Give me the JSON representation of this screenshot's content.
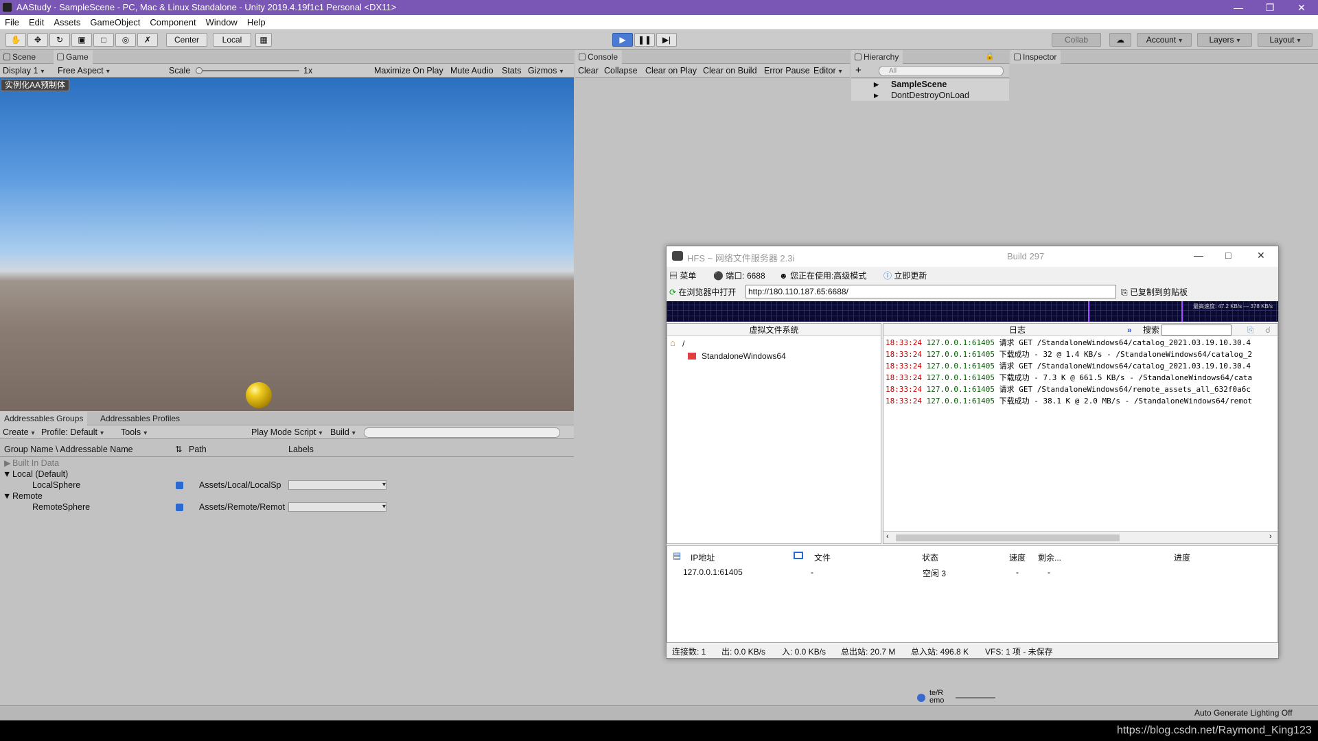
{
  "window": {
    "title": "AAStudy - SampleScene - PC, Mac & Linux Standalone - Unity 2019.4.19f1c1 Personal <DX11>"
  },
  "menu": [
    "File",
    "Edit",
    "Assets",
    "GameObject",
    "Component",
    "Window",
    "Help"
  ],
  "toolbar": {
    "center": "Center",
    "local": "Local",
    "collab": "Collab",
    "account": "Account",
    "layers": "Layers",
    "layout": "Layout"
  },
  "game": {
    "tab_scene": "Scene",
    "tab_game": "Game",
    "display": "Display 1",
    "aspect": "Free Aspect",
    "scale_label": "Scale",
    "scale_value": "1x",
    "maximize": "Maximize On Play",
    "mute": "Mute Audio",
    "stats": "Stats",
    "gizmos": "Gizmos",
    "instantiate_button": "实例化AA预制体"
  },
  "addressables": {
    "tab_groups": "Addressables Groups",
    "tab_profiles": "Addressables Profiles",
    "create": "Create",
    "profile": "Profile: Default",
    "tools": "Tools",
    "play_mode": "Play Mode Script",
    "build": "Build",
    "col_name": "Group Name \\ Addressable Name",
    "col_path": "Path",
    "col_labels": "Labels",
    "rows": [
      {
        "name": "Built In Data",
        "path": ""
      },
      {
        "name": "Local (Default)",
        "path": ""
      },
      {
        "name": "LocalSphere",
        "path": "Assets/Local/LocalSp"
      },
      {
        "name": "Remote",
        "path": ""
      },
      {
        "name": "RemoteSphere",
        "path": "Assets/Remote/Remot"
      }
    ]
  },
  "console": {
    "tab": "Console",
    "clear": "Clear",
    "collapse": "Collapse",
    "clear_on_play": "Clear on Play",
    "clear_on_build": "Clear on Build",
    "error_pause": "Error Pause",
    "editor": "Editor"
  },
  "hierarchy": {
    "tab": "Hierarchy",
    "search_placeholder": "All",
    "items": [
      "SampleScene",
      "DontDestroyOnLoad"
    ],
    "bottom_text": "te/R emo"
  },
  "inspector": {
    "tab": "Inspector"
  },
  "status": {
    "right": "Auto Generate Lighting Off"
  },
  "watermark": "https://blog.csdn.net/Raymond_King123",
  "hfs": {
    "title": "HFS ~ 网络文件服务器 2.3i",
    "build": "Build 297",
    "menu": "菜单",
    "port": "端口: 6688",
    "mode": "您正在使用:高级模式",
    "update": "立即更新",
    "open_browser": "在浏览器中打开",
    "url": "http://180.110.187.65:6688/",
    "copied": "已复制到剪贴板",
    "graph_label": "最高速度: 47.2 KB/s --- 378 KB/s",
    "vfs_header": "虚拟文件系统",
    "log_header": "日志",
    "search": "搜索",
    "vfs_root": "/",
    "vfs_folder": "StandaloneWindows64",
    "log": [
      {
        "t": "18:33:24",
        "ip": "127.0.0.1:61405",
        "m": "请求 GET /StandaloneWindows64/catalog_2021.03.19.10.30.4"
      },
      {
        "t": "18:33:24",
        "ip": "127.0.0.1:61405",
        "m": "下载成功 - 32 @ 1.4 KB/s - /StandaloneWindows64/catalog_2"
      },
      {
        "t": "18:33:24",
        "ip": "127.0.0.1:61405",
        "m": "请求 GET /StandaloneWindows64/catalog_2021.03.19.10.30.4"
      },
      {
        "t": "18:33:24",
        "ip": "127.0.0.1:61405",
        "m": "下载成功 - 7.3 K @ 661.5 KB/s - /StandaloneWindows64/cata"
      },
      {
        "t": "18:33:24",
        "ip": "127.0.0.1:61405",
        "m": "请求 GET /StandaloneWindows64/remote_assets_all_632f0a6c"
      },
      {
        "t": "18:33:24",
        "ip": "127.0.0.1:61405",
        "m": "下载成功 - 38.1 K @ 2.0 MB/s - /StandaloneWindows64/remot"
      }
    ],
    "conn_headers": {
      "ip": "IP地址",
      "file": "文件",
      "state": "状态",
      "speed": "速度",
      "remain": "剩余...",
      "progress": "进度"
    },
    "conn_row": {
      "ip": "127.0.0.1:61405",
      "file": "-",
      "state": "空闲 3",
      "speed": "-",
      "remain": "-"
    },
    "status": {
      "connections": "连接数: 1",
      "out": "出: 0.0 KB/s",
      "in": "入: 0.0 KB/s",
      "total_out": "总出站: 20.7 M",
      "total_in": "总入站: 496.8 K",
      "vfs": "VFS: 1 项 - 未保存"
    }
  }
}
